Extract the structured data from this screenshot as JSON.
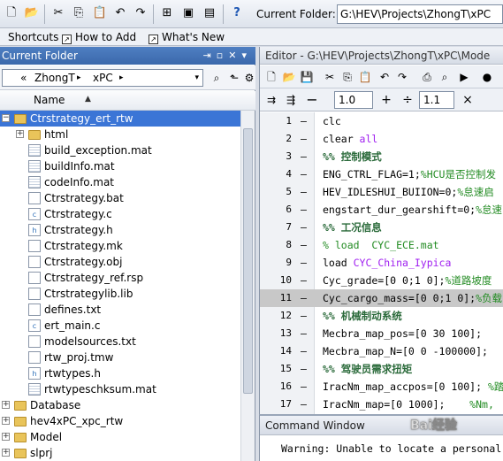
{
  "toolbar": {
    "current_folder_label": "Current Folder:",
    "current_folder_path": "G:\\HEV\\Projects\\ZhongT\\xPC"
  },
  "shortcuts": {
    "items": [
      "Shortcuts",
      "How to Add",
      "What's New"
    ]
  },
  "current_folder": {
    "title": "Current Folder",
    "address": [
      "«",
      "ZhongT",
      "▸",
      "xPC",
      "▸"
    ],
    "column_name": "Name",
    "sort_indicator": "▲",
    "tree": [
      {
        "name": "Ctrstrategy_ert_rtw",
        "type": "folder",
        "level": 0,
        "expander": "−",
        "selected": true
      },
      {
        "name": "html",
        "type": "folder",
        "level": 1,
        "expander": "+"
      },
      {
        "name": "build_exception.mat",
        "type": "mat",
        "level": 1
      },
      {
        "name": "buildInfo.mat",
        "type": "mat",
        "level": 1
      },
      {
        "name": "codeInfo.mat",
        "type": "mat",
        "level": 1
      },
      {
        "name": "Ctrstrategy.bat",
        "type": "file",
        "level": 1
      },
      {
        "name": "Ctrstrategy.c",
        "type": "c",
        "level": 1
      },
      {
        "name": "Ctrstrategy.h",
        "type": "h",
        "level": 1
      },
      {
        "name": "Ctrstrategy.mk",
        "type": "file",
        "level": 1
      },
      {
        "name": "Ctrstrategy.obj",
        "type": "file",
        "level": 1
      },
      {
        "name": "Ctrstrategy_ref.rsp",
        "type": "file",
        "level": 1
      },
      {
        "name": "Ctrstrategylib.lib",
        "type": "file",
        "level": 1
      },
      {
        "name": "defines.txt",
        "type": "file",
        "level": 1
      },
      {
        "name": "ert_main.c",
        "type": "c",
        "level": 1
      },
      {
        "name": "modelsources.txt",
        "type": "file",
        "level": 1
      },
      {
        "name": "rtw_proj.tmw",
        "type": "file",
        "level": 1
      },
      {
        "name": "rtwtypes.h",
        "type": "h",
        "level": 1
      },
      {
        "name": "rtwtypeschksum.mat",
        "type": "mat",
        "level": 1
      },
      {
        "name": "Database",
        "type": "folder",
        "level": 0,
        "expander": "+"
      },
      {
        "name": "hev4xPC_xpc_rtw",
        "type": "folder",
        "level": 0,
        "expander": "+"
      },
      {
        "name": "Model",
        "type": "folder",
        "level": 0,
        "expander": "+"
      },
      {
        "name": "slprj",
        "type": "folder",
        "level": 0,
        "expander": "+"
      }
    ]
  },
  "editor": {
    "title": "Editor - G:\\HEV\\Projects\\ZhongT\\xPC\\Mode",
    "cell_divisor_1": "1.0",
    "cell_divisor_2": "1.1",
    "minus_label": "−",
    "plus_label": "+",
    "div_label": "÷",
    "times_label": "×",
    "lines": [
      {
        "num": "1",
        "parts": [
          {
            "t": "clc",
            "c": ""
          }
        ]
      },
      {
        "num": "2",
        "parts": [
          {
            "t": "clear ",
            "c": ""
          },
          {
            "t": "all",
            "c": "str"
          }
        ]
      },
      {
        "num": "3",
        "parts": [
          {
            "t": "%% 控制模式",
            "c": "cell"
          }
        ]
      },
      {
        "num": "4",
        "parts": [
          {
            "t": "ENG_CTRL_FLAG=1;",
            "c": ""
          },
          {
            "t": "%HCU是否控制发",
            "c": "cmt"
          }
        ]
      },
      {
        "num": "5",
        "parts": [
          {
            "t": "HEV_IDLESHUI_BUIION=0;",
            "c": ""
          },
          {
            "t": "%怠速启",
            "c": "cmt"
          }
        ]
      },
      {
        "num": "6",
        "parts": [
          {
            "t": "engstart_dur_gearshift=0;",
            "c": ""
          },
          {
            "t": "%怠速",
            "c": "cmt"
          }
        ]
      },
      {
        "num": "7",
        "parts": [
          {
            "t": "%% 工况信息",
            "c": "cell"
          }
        ]
      },
      {
        "num": "8",
        "parts": [
          {
            "t": "% load  CYC_ECE.mat",
            "c": "cmt"
          }
        ]
      },
      {
        "num": "9",
        "parts": [
          {
            "t": "load ",
            "c": ""
          },
          {
            "t": "CYC_China_Iypica",
            "c": "str"
          }
        ]
      },
      {
        "num": "10",
        "parts": [
          {
            "t": "Cyc_grade=[0 0;1 0];",
            "c": ""
          },
          {
            "t": "%道路坡度",
            "c": "cmt"
          }
        ]
      },
      {
        "num": "11",
        "hl": true,
        "parts": [
          {
            "t": "Cyc_cargo_mass=[0 0;1 0];",
            "c": ""
          },
          {
            "t": "%负载",
            "c": "cmt"
          }
        ]
      },
      {
        "num": "12",
        "parts": [
          {
            "t": "%% 机械制动系统",
            "c": "cell"
          }
        ]
      },
      {
        "num": "13",
        "parts": [
          {
            "t": "Mecbra_map_pos=[0 30 100];",
            "c": ""
          }
        ]
      },
      {
        "num": "14",
        "parts": [
          {
            "t": "Mecbra_map_N=[0 0 -100000];",
            "c": ""
          }
        ]
      },
      {
        "num": "15",
        "parts": [
          {
            "t": "%% 驾驶员需求扭矩",
            "c": "cell"
          }
        ]
      },
      {
        "num": "16",
        "parts": [
          {
            "t": "IracNm_map_accpos=[0 100]; ",
            "c": ""
          },
          {
            "t": "%踏",
            "c": "cmt"
          }
        ]
      },
      {
        "num": "17",
        "parts": [
          {
            "t": "IracNm_map=[0 1000];    ",
            "c": ""
          },
          {
            "t": "%Nm,",
            "c": "cmt"
          }
        ]
      }
    ]
  },
  "command_window": {
    "title": "Command Window",
    "text": "Warning: Unable to locate a personal"
  },
  "watermark": "Baiđ经验"
}
